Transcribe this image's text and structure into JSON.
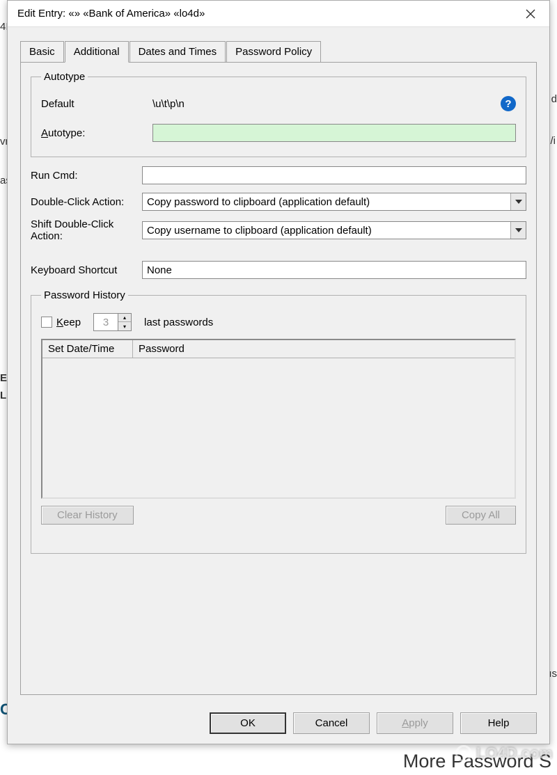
{
  "window": {
    "title": "Edit Entry:   «» «Bank of America» «lo4d»"
  },
  "tabs": {
    "basic": "Basic",
    "additional": "Additional",
    "dates": "Dates and Times",
    "policy": "Password Policy"
  },
  "autotype": {
    "legend": "Autotype",
    "default_label": "Default",
    "default_value": "\\u\\t\\p\\n",
    "autotype_label": "Autotype:",
    "autotype_value": ""
  },
  "runcmd": {
    "label": "Run Cmd:",
    "value": ""
  },
  "dca": {
    "label": "Double-Click Action:",
    "value": "Copy password to clipboard (application default)"
  },
  "sdca": {
    "label": "Shift Double-Click Action:",
    "value": "Copy username to clipboard (application default)"
  },
  "shortcut": {
    "label": "Keyboard Shortcut",
    "value": "None"
  },
  "history": {
    "legend": "Password History",
    "keep_label": "Keep",
    "keep_count": "3",
    "suffix": "last passwords",
    "col1": "Set Date/Time",
    "col2": "Password",
    "clear_btn": "Clear History",
    "copy_btn": "Copy All"
  },
  "buttons": {
    "ok": "OK",
    "cancel": "Cancel",
    "apply": "Apply",
    "help": "Help"
  },
  "watermark": "LO4D.com",
  "bg_bottom": "More Password S"
}
